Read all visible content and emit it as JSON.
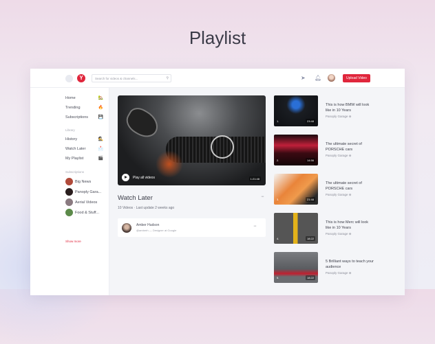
{
  "page_title": "Playlist",
  "header": {
    "logo": "Y",
    "search_placeholder": "Search for videos & channels...",
    "upload": "Upload Video"
  },
  "sidebar": {
    "main": [
      {
        "label": "Home",
        "icon": "🏡"
      },
      {
        "label": "Trending",
        "icon": "🔥"
      },
      {
        "label": "Subscriptions",
        "icon": "💾"
      }
    ],
    "library_label": "Library",
    "library": [
      {
        "label": "History",
        "icon": "🕵"
      },
      {
        "label": "Watch Later",
        "icon": "📩"
      },
      {
        "label": "My Playlist",
        "icon": "🎬"
      }
    ],
    "subs_label": "Subscriptions",
    "subs": [
      {
        "label": "Big News"
      },
      {
        "label": "Panoply Gara..."
      },
      {
        "label": "Aerial Videos"
      },
      {
        "label": "Food & Stuff..."
      }
    ],
    "show_more": "Show more"
  },
  "hero": {
    "play_label": "Play all videos",
    "duration": "1:21:48"
  },
  "playlist": {
    "title": "Watch Later",
    "meta": "10 Videos · Last update 2 weeks ago",
    "more": "···"
  },
  "owner": {
    "name": "Amber Hudson",
    "role": "@amberh — Designer at Google",
    "more": "···"
  },
  "videos": [
    {
      "num": "1.",
      "duration": "23:48",
      "title": "This is how BMW will look like in 10 Years",
      "channel": "Panoply Garage"
    },
    {
      "num": "2.",
      "duration": "14:56",
      "title": "The ultimate secret of PORSCHE cars",
      "channel": "Panoply Garage"
    },
    {
      "num": "3.",
      "duration": "21:48",
      "title": "The ultimate secret of PORSCHE cars",
      "channel": "Panoply Garage"
    },
    {
      "num": "4.",
      "duration": "18:22",
      "title": "This is how Merc will look like in 10 Years",
      "channel": "Panoply Garage"
    },
    {
      "num": "5.",
      "duration": "18:22",
      "title": "5 Brilliant ways to teach your audience",
      "channel": "Panoply Garage"
    }
  ],
  "verified_icon": "⊛",
  "colors": {
    "accent": "#e0263c"
  }
}
